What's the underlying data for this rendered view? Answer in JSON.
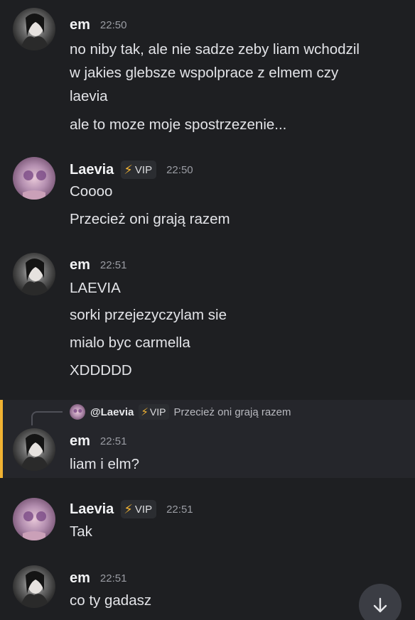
{
  "messages": [
    {
      "author": "em",
      "time": "22:50",
      "avatar": "em-avatar",
      "lines": [
        "no niby tak, ale nie sadze zeby liam wchodzil",
        "w jakies glebsze wspolprace z elmem czy",
        "laevia",
        "ale to moze moje spostrzezenie..."
      ]
    },
    {
      "author": "Laevia",
      "badge": "VIP",
      "time": "22:50",
      "avatar": "laevia-avatar",
      "lines": [
        "Coooo",
        "Przecież oni grają razem"
      ]
    },
    {
      "author": "em",
      "time": "22:51",
      "avatar": "em-avatar",
      "lines": [
        "LAEVIA",
        "sorki przejezyczylam sie",
        "mialo byc carmella",
        "XDDDDD"
      ]
    },
    {
      "author": "em",
      "time": "22:51",
      "avatar": "em-avatar",
      "reply": {
        "author": "@Laevia",
        "badge": "VIP",
        "text": "Przecież oni grają razem"
      },
      "lines": [
        "liam i elm?"
      ]
    },
    {
      "author": "Laevia",
      "badge": "VIP",
      "time": "22:51",
      "avatar": "laevia-avatar",
      "lines": [
        "Tak"
      ]
    },
    {
      "author": "em",
      "time": "22:51",
      "avatar": "em-avatar",
      "lines": [
        "co ty gadasz"
      ]
    }
  ],
  "icons": {
    "badge": "lightning-icon",
    "scroll": "arrow-down-icon"
  },
  "colors": {
    "background": "#1e1f22",
    "mention_highlight": "#f0b232",
    "badge_bolt": "#f0b232"
  }
}
